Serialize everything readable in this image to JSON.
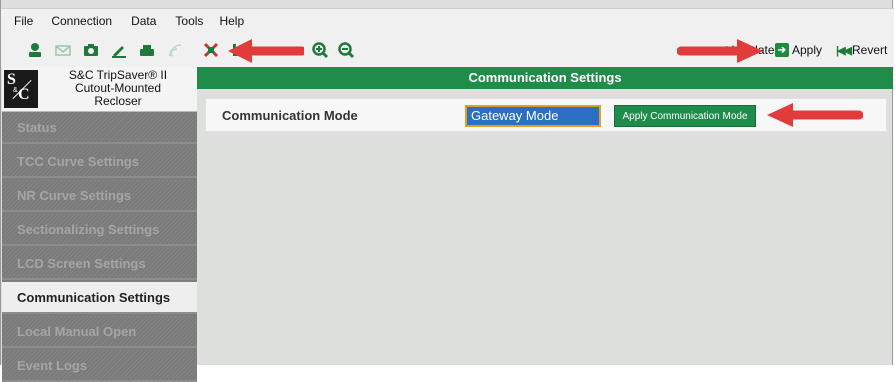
{
  "menu": [
    "File",
    "Connection",
    "Data",
    "Tools",
    "Help"
  ],
  "toolbar": {
    "icons": [
      "connect-icon",
      "mail-icon",
      "camera-icon",
      "edit-icon",
      "print-icon",
      "signal-icon",
      "disconnect-icon",
      "save-icon",
      "zoom-in-icon",
      "zoom-out-icon"
    ],
    "validate_label": "Validate",
    "apply_label": "Apply",
    "revert_label": "Revert"
  },
  "device": {
    "name_line1": "S&C TripSaver® II",
    "name_line2": "Cutout-Mounted",
    "name_line3": "Recloser",
    "logo": "S&C"
  },
  "sidebar": {
    "items": [
      {
        "label": "Status"
      },
      {
        "label": "TCC Curve Settings"
      },
      {
        "label": "NR Curve Settings"
      },
      {
        "label": "Sectionalizing Settings"
      },
      {
        "label": "LCD Screen Settings"
      },
      {
        "label": "Communication Settings"
      },
      {
        "label": "Local Manual Open"
      },
      {
        "label": "Event Logs"
      }
    ],
    "active": "Communication Settings"
  },
  "main": {
    "title": "Communication Settings",
    "mode_label": "Communication Mode",
    "mode_value": "Gateway Mode",
    "apply_mode_button": "Apply Communication Mode"
  },
  "colors": {
    "accent_green": "#1f8c4a",
    "annotation_red": "#e23b3b",
    "field_blue": "#2a6fc3"
  }
}
